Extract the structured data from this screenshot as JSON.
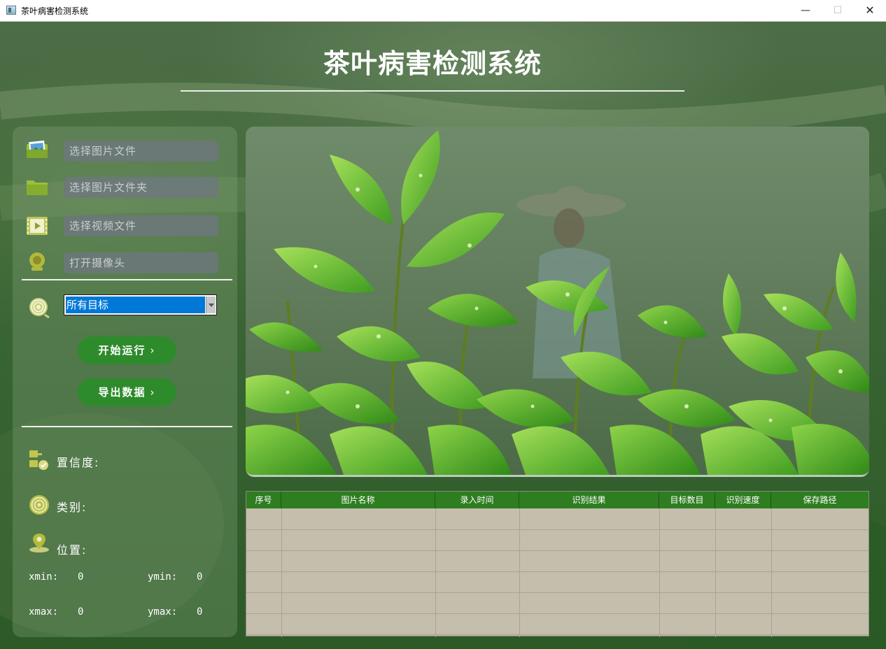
{
  "window": {
    "title": "茶叶病害检测系统",
    "controls": {
      "minimize": "—",
      "maximize": "☐",
      "close": "✕"
    }
  },
  "header": {
    "title": "茶叶病害检测系统"
  },
  "inputs": {
    "image_file": "选择图片文件",
    "image_folder": "选择图片文件夹",
    "video_file": "选择视频文件",
    "camera": "打开摄像头"
  },
  "target_select": {
    "value": "所有目标"
  },
  "buttons": {
    "start": "开始运行",
    "export": "导出数据",
    "chevron": "›"
  },
  "info": {
    "confidence_label": "置信度:",
    "class_label": "类别:",
    "position_label": "位置:",
    "xmin_label": "xmin:",
    "xmin": "0",
    "ymin_label": "ymin:",
    "ymin": "0",
    "xmax_label": "xmax:",
    "xmax": "0",
    "ymax_label": "ymax:",
    "ymax": "0"
  },
  "table": {
    "columns": [
      "序号",
      "图片名称",
      "录入时间",
      "识别结果",
      "目标数目",
      "识别速度",
      "保存路径"
    ],
    "rows": []
  },
  "colors": {
    "accent": "#2e8b2c",
    "table_header": "#2e7d20",
    "select_highlight": "#0078d7"
  }
}
